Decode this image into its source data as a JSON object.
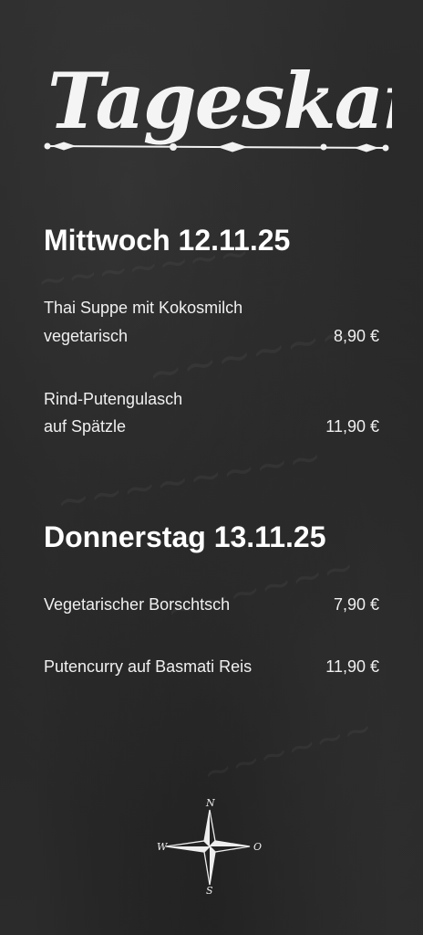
{
  "board": {
    "title": "Tageskarte"
  },
  "days": [
    {
      "heading": "Mittwoch 12.11.25",
      "items": [
        {
          "line1": "Thai Suppe mit Kokosmilch",
          "line2": "vegetarisch",
          "price": "8,90 €"
        },
        {
          "line1": "Rind-Putengulasch",
          "line2": "auf Spätzle",
          "price": "11,90 €"
        }
      ]
    },
    {
      "heading": "Donnerstag 13.11.25",
      "items": [
        {
          "line1": "Vegetarischer Borschtsch",
          "price": "7,90 €"
        },
        {
          "line1": "Putencurry auf Basmati Reis",
          "price": "11,90 €"
        }
      ]
    }
  ],
  "compass": {
    "north": "N",
    "west": "W",
    "east": "O",
    "south": "S"
  },
  "colors": {
    "chalkboard": "#2a2a2a",
    "chalk": "#f2f2f2"
  },
  "icons": [
    "compass-rose-icon",
    "ornament-divider-icon"
  ]
}
